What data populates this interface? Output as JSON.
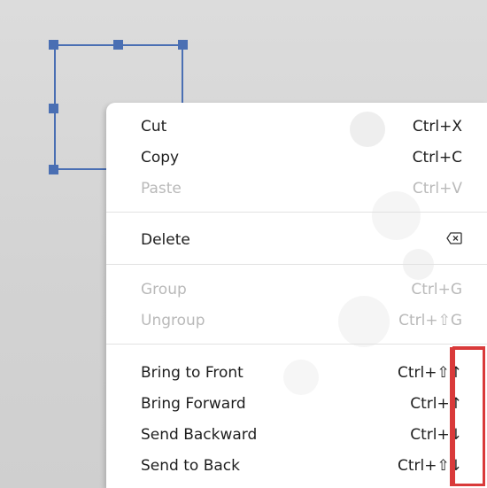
{
  "menu": {
    "cut": {
      "label": "Cut",
      "shortcut": "Ctrl+X"
    },
    "copy": {
      "label": "Copy",
      "shortcut": "Ctrl+C"
    },
    "paste": {
      "label": "Paste",
      "shortcut": "Ctrl+V"
    },
    "delete": {
      "label": "Delete",
      "shortcut_icon": "backspace-icon"
    },
    "group": {
      "label": "Group",
      "shortcut": "Ctrl+G"
    },
    "ungroup": {
      "label": "Ungroup",
      "shortcut": "Ctrl+⇧G"
    },
    "bring_to_front": {
      "label": "Bring to Front",
      "shortcut": "Ctrl+⇧↑"
    },
    "bring_forward": {
      "label": "Bring Forward",
      "shortcut": "Ctrl+↑"
    },
    "send_backward": {
      "label": "Send Backward",
      "shortcut": "Ctrl+↓"
    },
    "send_to_back": {
      "label": "Send to Back",
      "shortcut": "Ctrl+⇧↓"
    }
  },
  "colors": {
    "selection": "#4a6fb3",
    "highlight_outline": "#d93a3a",
    "disabled_text": "#b9b9b9",
    "text": "#1e1e1e"
  }
}
